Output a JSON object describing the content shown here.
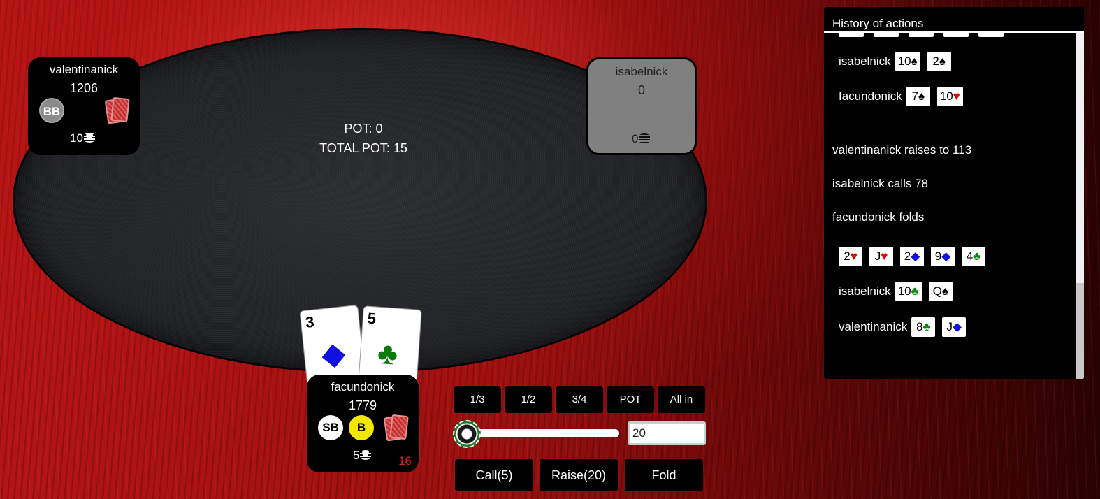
{
  "table": {
    "pot_label": "POT: 0",
    "total_pot_label": "TOTAL POT: 15"
  },
  "players": {
    "valentina": {
      "name": "valentinanick",
      "stack": "1206",
      "bet": "10",
      "badge": "BB"
    },
    "isabel": {
      "name": "isabelnick",
      "stack": "0",
      "bet": "0"
    },
    "facundo": {
      "name": "facundonick",
      "stack": "1779",
      "bet": "5",
      "badge_sb": "SB",
      "badge_dealer": "B",
      "timer": "16"
    }
  },
  "hero_cards": [
    {
      "rank": "3",
      "suit": "◆",
      "color": "#1010e0"
    },
    {
      "rank": "5",
      "suit": "♣",
      "color": "#0a7a0a"
    }
  ],
  "bet_controls": {
    "presets": [
      "1/3",
      "1/2",
      "3/4",
      "POT",
      "All in"
    ],
    "amount": "20",
    "call_label": "Call(5)",
    "raise_label": "Raise(20)",
    "fold_label": "Fold"
  },
  "history": {
    "title": "History of actions",
    "entries": {
      "isabel_show": {
        "name": "isabelnick",
        "c1": "10",
        "s1": "♠",
        "c2": "2",
        "s2": "♠"
      },
      "facundo_show": {
        "name": "facundonick",
        "c1": "7",
        "s1": "♠",
        "c2": "10",
        "s2": "♥"
      },
      "a1": "valentinanick raises to 113",
      "a2": "isabelnick calls 78",
      "a3": "facundonick folds",
      "board": [
        {
          "r": "2",
          "s": "♥"
        },
        {
          "r": "J",
          "s": "♥"
        },
        {
          "r": "2",
          "s": "◆"
        },
        {
          "r": "9",
          "s": "◆"
        },
        {
          "r": "4",
          "s": "♣"
        }
      ],
      "isabel_show2": {
        "name": "isabelnick",
        "c1": "10",
        "s1": "♣",
        "c2": "Q",
        "s2": "♠"
      },
      "valentina_show": {
        "name": "valentinanick",
        "c1": "8",
        "s1": "♣",
        "c2": "J",
        "s2": "◆"
      }
    }
  }
}
